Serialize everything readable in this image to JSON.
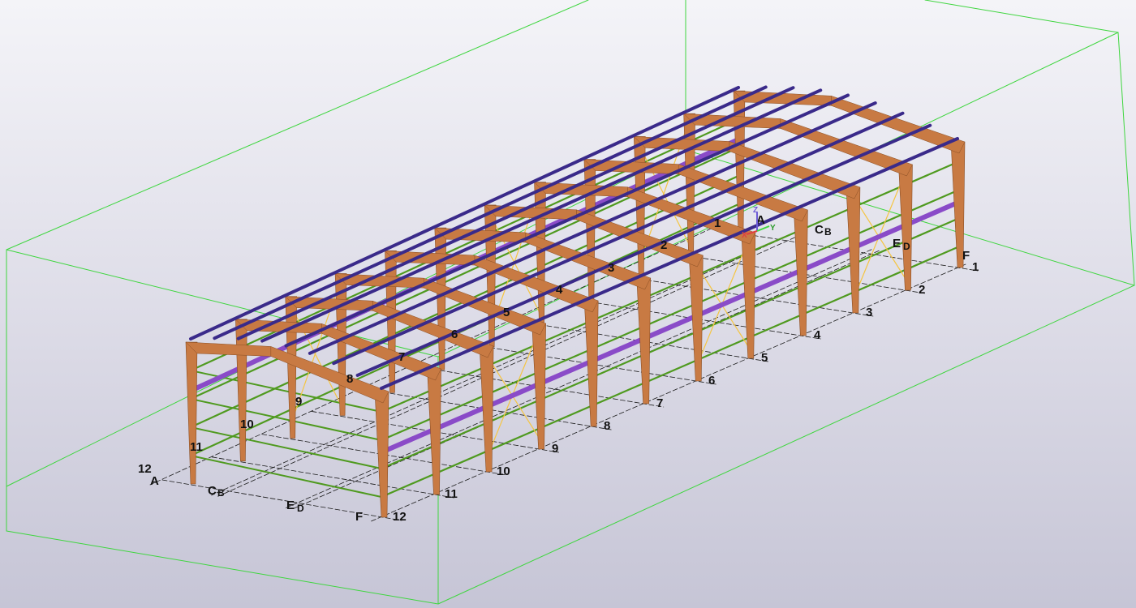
{
  "view": {
    "background_top": "#f4f4f8",
    "background_bottom": "#c6c5d6",
    "colors": {
      "work_area_box": "#3fd63f",
      "gridline": "#1a1a1a",
      "column": "#c87a43",
      "rafter": "#c87a43",
      "purlin": "#3a2a8a",
      "girt": "#4f9a1f",
      "eave_strut": "#8a4bc8",
      "bracing": "#f5c542",
      "plate": "#d8c8e8"
    }
  },
  "model": {
    "grid_axes_numbered": [
      "1",
      "2",
      "3",
      "4",
      "5",
      "6",
      "7",
      "8",
      "9",
      "10",
      "11",
      "12"
    ],
    "grid_axes_lettered": [
      "A",
      "B",
      "C",
      "D",
      "E",
      "F"
    ],
    "labels": {
      "near_right_numbers": [
        "1",
        "2",
        "3",
        "4",
        "5",
        "6",
        "7",
        "8",
        "9",
        "10",
        "11",
        "12"
      ],
      "far_left_numbers": [
        "1",
        "2",
        "3",
        "4",
        "5",
        "6",
        "7",
        "8",
        "9",
        "10",
        "11",
        "12"
      ],
      "front_letters": [
        "A",
        "C",
        "B",
        "E",
        "D",
        "F"
      ],
      "back_letters": [
        "A",
        "C",
        "B",
        "E",
        "D",
        "F"
      ]
    },
    "coordinate_symbol": {
      "z_label": "Z",
      "y_label": "Y",
      "x_label": "X"
    }
  }
}
